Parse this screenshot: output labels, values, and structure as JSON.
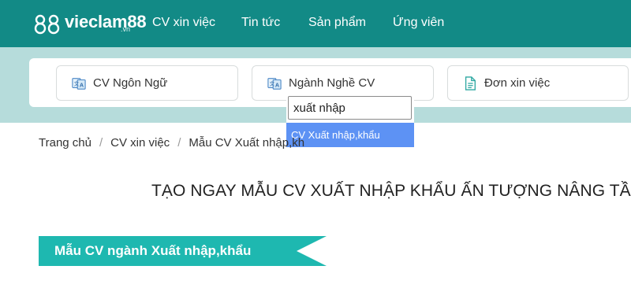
{
  "header": {
    "logo_text": "vieclam88",
    "logo_sub": ".vn",
    "nav": [
      {
        "label": "CV xin việc"
      },
      {
        "label": "Tin tức"
      },
      {
        "label": "Sản phẩm"
      },
      {
        "label": "Ứng viên"
      }
    ]
  },
  "categories": [
    {
      "label": "CV Ngôn Ngữ",
      "icon": "translate-icon"
    },
    {
      "label": "Ngành Nghề CV",
      "icon": "translate-icon"
    },
    {
      "label": "Đơn xin việc",
      "icon": "document-icon"
    }
  ],
  "dropdown": {
    "input_value": "xuất nhập",
    "option": "CV Xuất nhập,khẩu"
  },
  "breadcrumb": [
    "Trang chủ",
    "CV xin việc",
    "Mẫu CV Xuất nhập,kh"
  ],
  "headline": "TẠO NGAY MẪU CV XUẤT NHẬP KHẨU ẤN TƯỢNG NÂNG TẦM",
  "section_ribbon": "Mẫu CV ngành Xuất nhập,khẩu",
  "colors": {
    "header": "#128a86",
    "band": "#b6dcdb",
    "ribbon": "#1eb8b0",
    "dropdown_highlight": "#5d92f4"
  }
}
